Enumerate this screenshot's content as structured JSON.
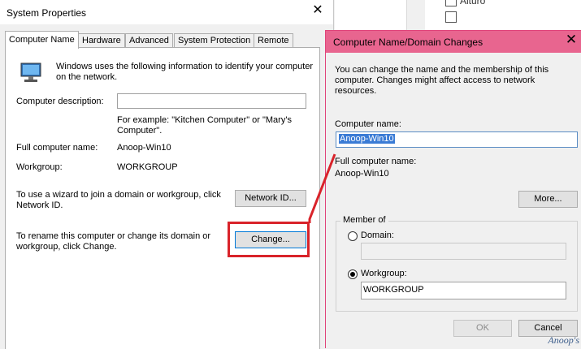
{
  "background_app": {
    "partial_text": "Aituro",
    "checkbox_label": ""
  },
  "system_properties": {
    "title": "System Properties",
    "close_glyph": "✕",
    "tabs": [
      {
        "label": "Computer Name",
        "active": true
      },
      {
        "label": "Hardware",
        "active": false
      },
      {
        "label": "Advanced",
        "active": false
      },
      {
        "label": "System Protection",
        "active": false
      },
      {
        "label": "Remote",
        "active": false
      }
    ],
    "intro_text": "Windows uses the following information to identify your computer on the network.",
    "description_label": "Computer description:",
    "description_value": "",
    "example_text": "For example: \"Kitchen Computer\" or \"Mary's Computer\".",
    "full_name_label": "Full computer name:",
    "full_name_value": "Anoop-Win10",
    "workgroup_label": "Workgroup:",
    "workgroup_value": "WORKGROUP",
    "wizard_text": "To use a wizard to join a domain or workgroup, click Network ID.",
    "network_id_button": "Network ID...",
    "rename_text": "To rename this computer or change its domain or workgroup, click Change.",
    "change_button": "Change..."
  },
  "dialog": {
    "title": "Computer Name/Domain Changes",
    "close_glyph": "✕",
    "intro_text": "You can change the name and the membership of this computer. Changes might affect access to network resources.",
    "computer_name_label": "Computer name:",
    "computer_name_value": "Anoop-Win10",
    "full_name_label": "Full computer name:",
    "full_name_value": "Anoop-Win10",
    "more_button": "More...",
    "member_of_label": "Member of",
    "domain_label": "Domain:",
    "domain_value": "",
    "domain_selected": false,
    "workgroup_label": "Workgroup:",
    "workgroup_value": "WORKGROUP",
    "workgroup_selected": true,
    "ok_button": "OK",
    "cancel_button": "Cancel"
  },
  "annotation": {
    "highlight_color": "#d9232a",
    "watermark": "Anoop's"
  },
  "colors": {
    "dialog_titlebar": "#e8658f",
    "selection": "#3a7bd5",
    "window_bg": "#f0f0f0"
  }
}
